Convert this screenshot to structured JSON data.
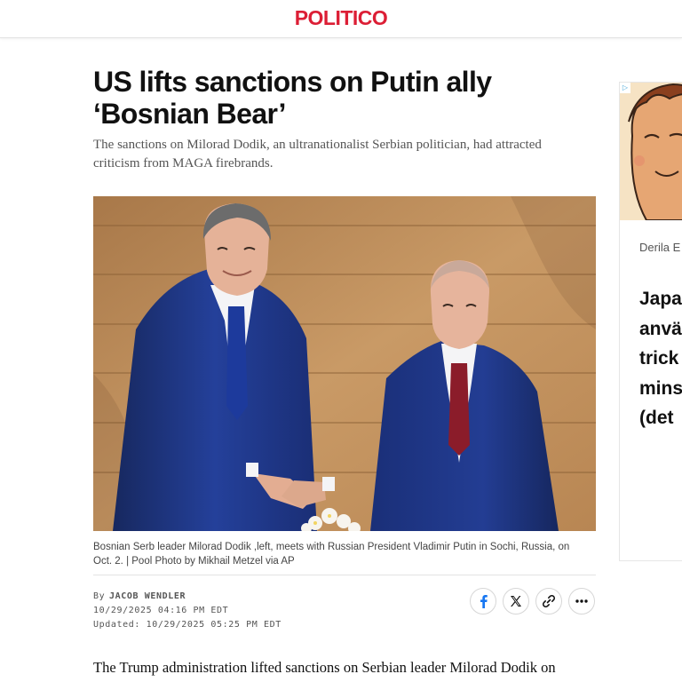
{
  "header": {
    "logo": "POLITICO"
  },
  "article": {
    "headline_line1": "US lifts sanctions on Putin ally",
    "headline_line2": "‘Bosnian Bear’",
    "dek_line1": "The sanctions on Milorad Dodik, an ultranationalist Serbian politician, had attracted",
    "dek_line2": "criticism from MAGA firebrands.",
    "caption_line1": "Bosnian Serb leader Milorad Dodik ,left, meets with Russian President Vladimir Putin in Sochi, Russia, on",
    "caption_line2": "Oct. 2. | Pool Photo by Mikhail Metzel via AP",
    "byline_prefix": "By",
    "author": "JACOB WENDLER",
    "published": "10/29/2025 04:16 PM EDT",
    "updated": "Updated: 10/29/2025 05:25 PM EDT",
    "body_first_line": "The Trump administration lifted sanctions on Serbian leader Milorad Dodik on"
  },
  "share": {
    "buttons": [
      {
        "name": "facebook-share-button",
        "icon": "facebook-icon"
      },
      {
        "name": "x-share-button",
        "icon": "x-icon"
      },
      {
        "name": "copy-link-button",
        "icon": "link-icon"
      },
      {
        "name": "more-share-button",
        "icon": "more-icon"
      }
    ]
  },
  "ad": {
    "source": "Derila E",
    "headline_lines": [
      "Japa",
      "anvä",
      "trick",
      "mins",
      "(det"
    ]
  },
  "colors": {
    "brand": "#dc1e35",
    "facebook": "#1877f2",
    "suit": "#1c2f7a",
    "wall": "#c08a52"
  }
}
